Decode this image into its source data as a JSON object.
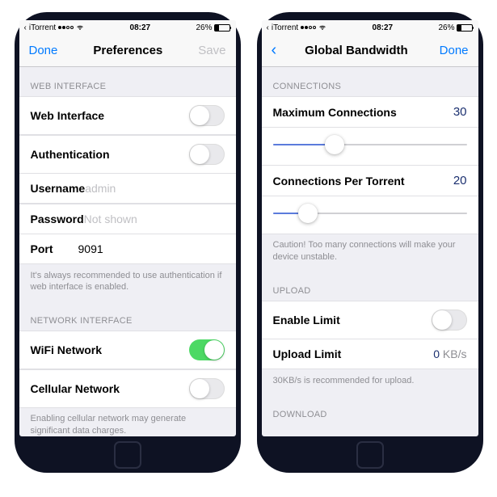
{
  "status": {
    "carrier": "iTorrent",
    "time": "08:27",
    "battery": "26%"
  },
  "left": {
    "nav": {
      "left": "Done",
      "title": "Preferences",
      "right": "Save"
    },
    "sections": {
      "web": {
        "header": "WEB INTERFACE",
        "webinterface": "Web Interface",
        "auth": "Authentication",
        "username_label": "Username",
        "username_placeholder": "admin",
        "password_label": "Password",
        "password_placeholder": "Not shown",
        "port_label": "Port",
        "port_value": "9091",
        "footer": "It's always recommended to use authentication if web interface is enabled."
      },
      "net": {
        "header": "NETWORK INTERFACE",
        "wifi": "WiFi Network",
        "cell": "Cellular Network",
        "footer": "Enabling cellular network may generate significant data charges."
      }
    }
  },
  "right": {
    "nav": {
      "title": "Global Bandwidth",
      "right": "Done"
    },
    "sections": {
      "conn": {
        "header": "CONNECTIONS",
        "max_label": "Maximum Connections",
        "max_value": "30",
        "per_label": "Connections Per Torrent",
        "per_value": "20",
        "footer": "Caution! Too many connections will make your device unstable."
      },
      "upload": {
        "header": "UPLOAD",
        "enable": "Enable Limit",
        "limit_label": "Upload Limit",
        "limit_value": "0",
        "limit_unit": "KB/s",
        "footer": "30KB/s is recommended for upload."
      },
      "download": {
        "header": "DOWNLOAD"
      }
    }
  }
}
